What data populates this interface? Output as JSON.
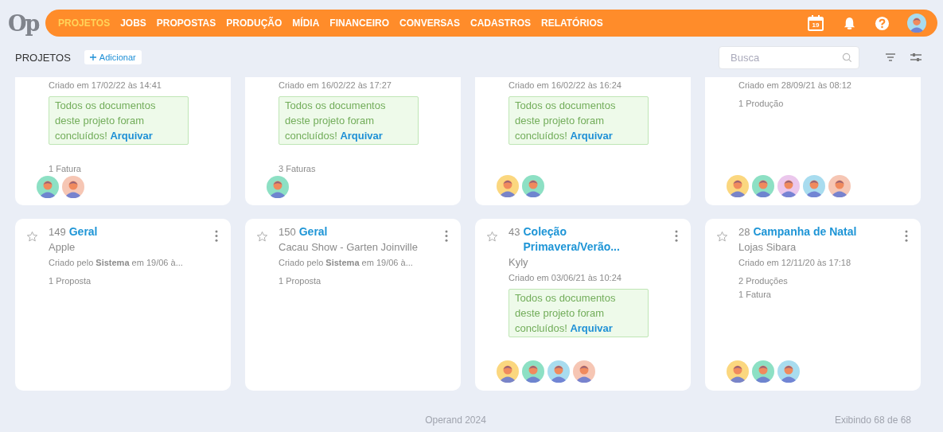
{
  "logo": "Op",
  "nav": [
    {
      "label": "PROJETOS",
      "selected": true
    },
    {
      "label": "JOBS",
      "selected": false
    },
    {
      "label": "PROPOSTAS",
      "selected": false
    },
    {
      "label": "PRODUÇÃO",
      "selected": false
    },
    {
      "label": "MÍDIA",
      "selected": false
    },
    {
      "label": "FINANCEIRO",
      "selected": false
    },
    {
      "label": "CONVERSAS",
      "selected": false
    },
    {
      "label": "CADASTROS",
      "selected": false
    },
    {
      "label": "RELATÓRIOS",
      "selected": false
    }
  ],
  "calendar_day": "19",
  "user_avatar": {
    "color": "#a8dcef"
  },
  "toolbar": {
    "title": "PROJETOS",
    "add_button": "Adicionar",
    "search": {
      "placeholder": "Busca"
    }
  },
  "cards": [
    {
      "created": "Criado em 17/02/22 às 14:41",
      "notice": {
        "text": "Todos os documentos deste projeto foram concluídos!",
        "link": "Arquivar"
      },
      "counts": [
        "1 Fatura"
      ],
      "avatars": [
        {
          "color": "#8de0c4"
        },
        {
          "color": "#f6c6b4"
        }
      ]
    },
    {
      "created": "Criado em 16/02/22 às 17:27",
      "notice": {
        "text": "Todos os documentos deste projeto foram concluídos!",
        "link": "Arquivar"
      },
      "counts": [
        "3 Faturas"
      ],
      "avatars": [
        {
          "color": "#8de0c4"
        }
      ]
    },
    {
      "created": "Criado em 16/02/22 às 16:24",
      "notice": {
        "text": "Todos os documentos deste projeto foram concluídos!",
        "link": "Arquivar"
      },
      "avatars": [
        {
          "color": "#fbd77f"
        },
        {
          "color": "#8de0c4"
        }
      ]
    },
    {
      "created": "Criado em 28/09/21 às 08:12",
      "counts": [
        "1 Produção"
      ],
      "avatars": [
        {
          "color": "#fbd77f"
        },
        {
          "color": "#8de0c4"
        },
        {
          "color": "#ebc7ec"
        },
        {
          "color": "#a8dcef"
        },
        {
          "color": "#f6c6b4"
        }
      ]
    },
    {
      "starred": false,
      "number": "149",
      "title": "Geral",
      "client": "Apple",
      "created": "Criado pelo **Sistema** em 19/06 à...",
      "counts": [
        "1 Proposta"
      ]
    },
    {
      "starred": false,
      "number": "150",
      "title": "Geral",
      "client": "Cacau Show - Garten Joinville",
      "created": "Criado pelo **Sistema** em 19/06 à...",
      "counts": [
        "1 Proposta"
      ]
    },
    {
      "starred": false,
      "number": "43",
      "title": "Coleção Primavera/Verão...",
      "client": "Kyly",
      "created": "Criado em 03/06/21 às 10:24",
      "notice": {
        "text": "Todos os documentos deste projeto foram concluídos!",
        "link": "Arquivar"
      },
      "avatars": [
        {
          "color": "#fbd77f"
        },
        {
          "color": "#8de0c4"
        },
        {
          "color": "#a8dcef"
        },
        {
          "color": "#f6c6b4"
        }
      ]
    },
    {
      "starred": false,
      "number": "28",
      "title": "Campanha de Natal",
      "client": "Lojas Sibara",
      "created": "Criado em 12/11/20 às 17:18",
      "counts": [
        "2 Produções",
        "1 Fatura"
      ],
      "avatars": [
        {
          "color": "#fbd77f"
        },
        {
          "color": "#8de0c4"
        },
        {
          "color": "#a8dcef"
        }
      ]
    }
  ],
  "footer": {
    "copyright": "Operand 2024",
    "showing": "Exibindo 68 de 68"
  }
}
